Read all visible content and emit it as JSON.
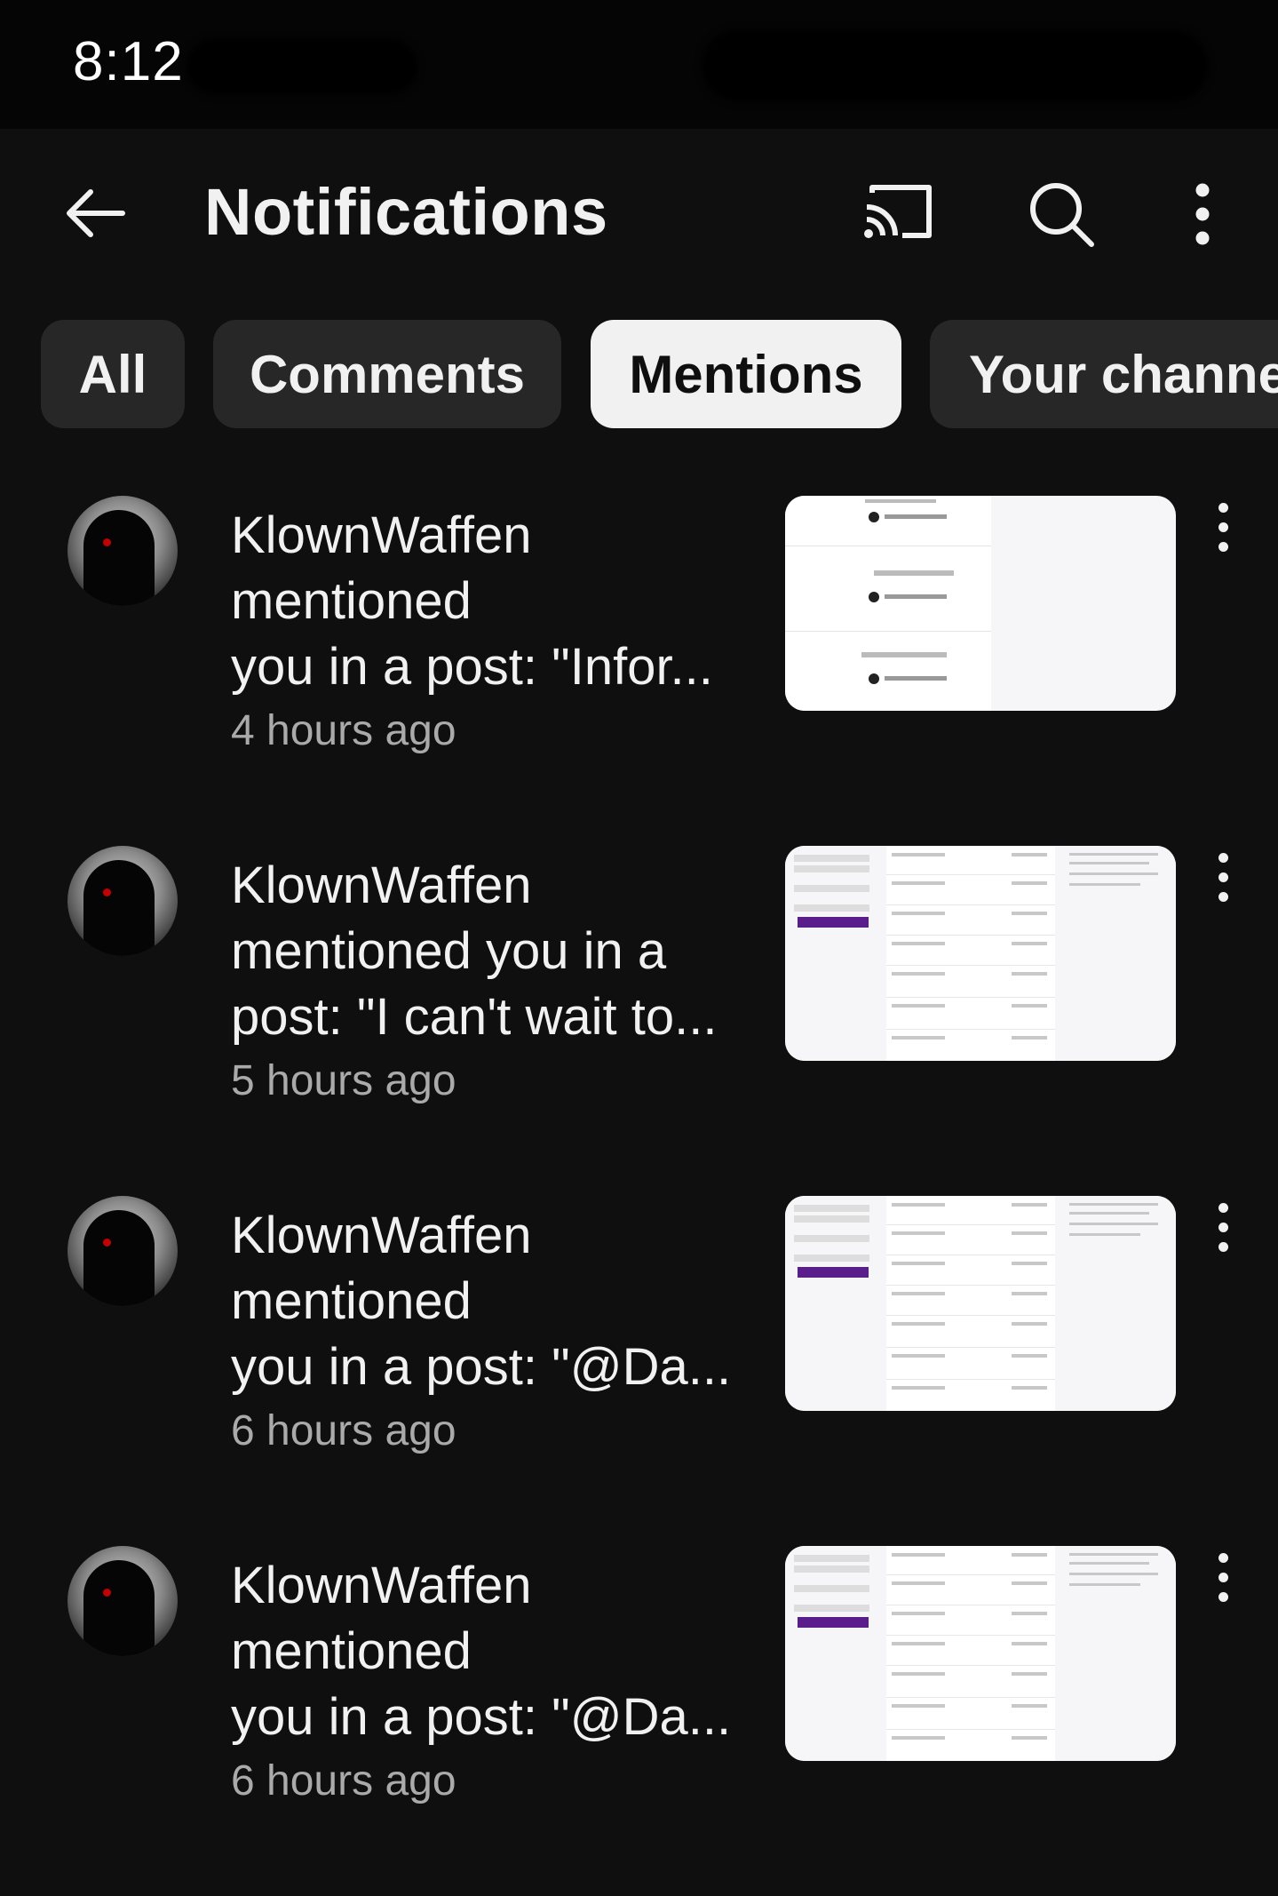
{
  "status_bar": {
    "time": "8:12"
  },
  "header": {
    "title": "Notifications"
  },
  "tabs": [
    {
      "label": "All",
      "active": false
    },
    {
      "label": "Comments",
      "active": false
    },
    {
      "label": "Mentions",
      "active": true
    },
    {
      "label": "Your channe",
      "active": false
    }
  ],
  "notifications": [
    {
      "user": "KlownWaffen",
      "message": "KlownWaffen\nmentioned\nyou in a post: \"Infor...",
      "time": "4 hours ago",
      "thumbnail": "list-preview"
    },
    {
      "user": "KlownWaffen",
      "message": "KlownWaffen\nmentioned you in a\npost: \"I can't wait to...",
      "time": "5 hours ago",
      "thumbnail": "search-results-preview"
    },
    {
      "user": "KlownWaffen",
      "message": "KlownWaffen\nmentioned\nyou in a post: \"@Da...",
      "time": "6 hours ago",
      "thumbnail": "search-results-preview"
    },
    {
      "user": "KlownWaffen",
      "message": "KlownWaffen\nmentioned\nyou in a post: \"@Da...",
      "time": "6 hours ago",
      "thumbnail": "search-results-preview"
    }
  ],
  "icons": {
    "back": "arrow-left-icon",
    "cast": "cast-icon",
    "search": "search-icon",
    "more": "more-vert-icon"
  },
  "colors": {
    "background": "#0f0f0f",
    "chip": "#272727",
    "chip_active": "#f1f1f1",
    "secondary_text": "#aaaaaa",
    "accent_thumb": "#5a1e8c"
  }
}
